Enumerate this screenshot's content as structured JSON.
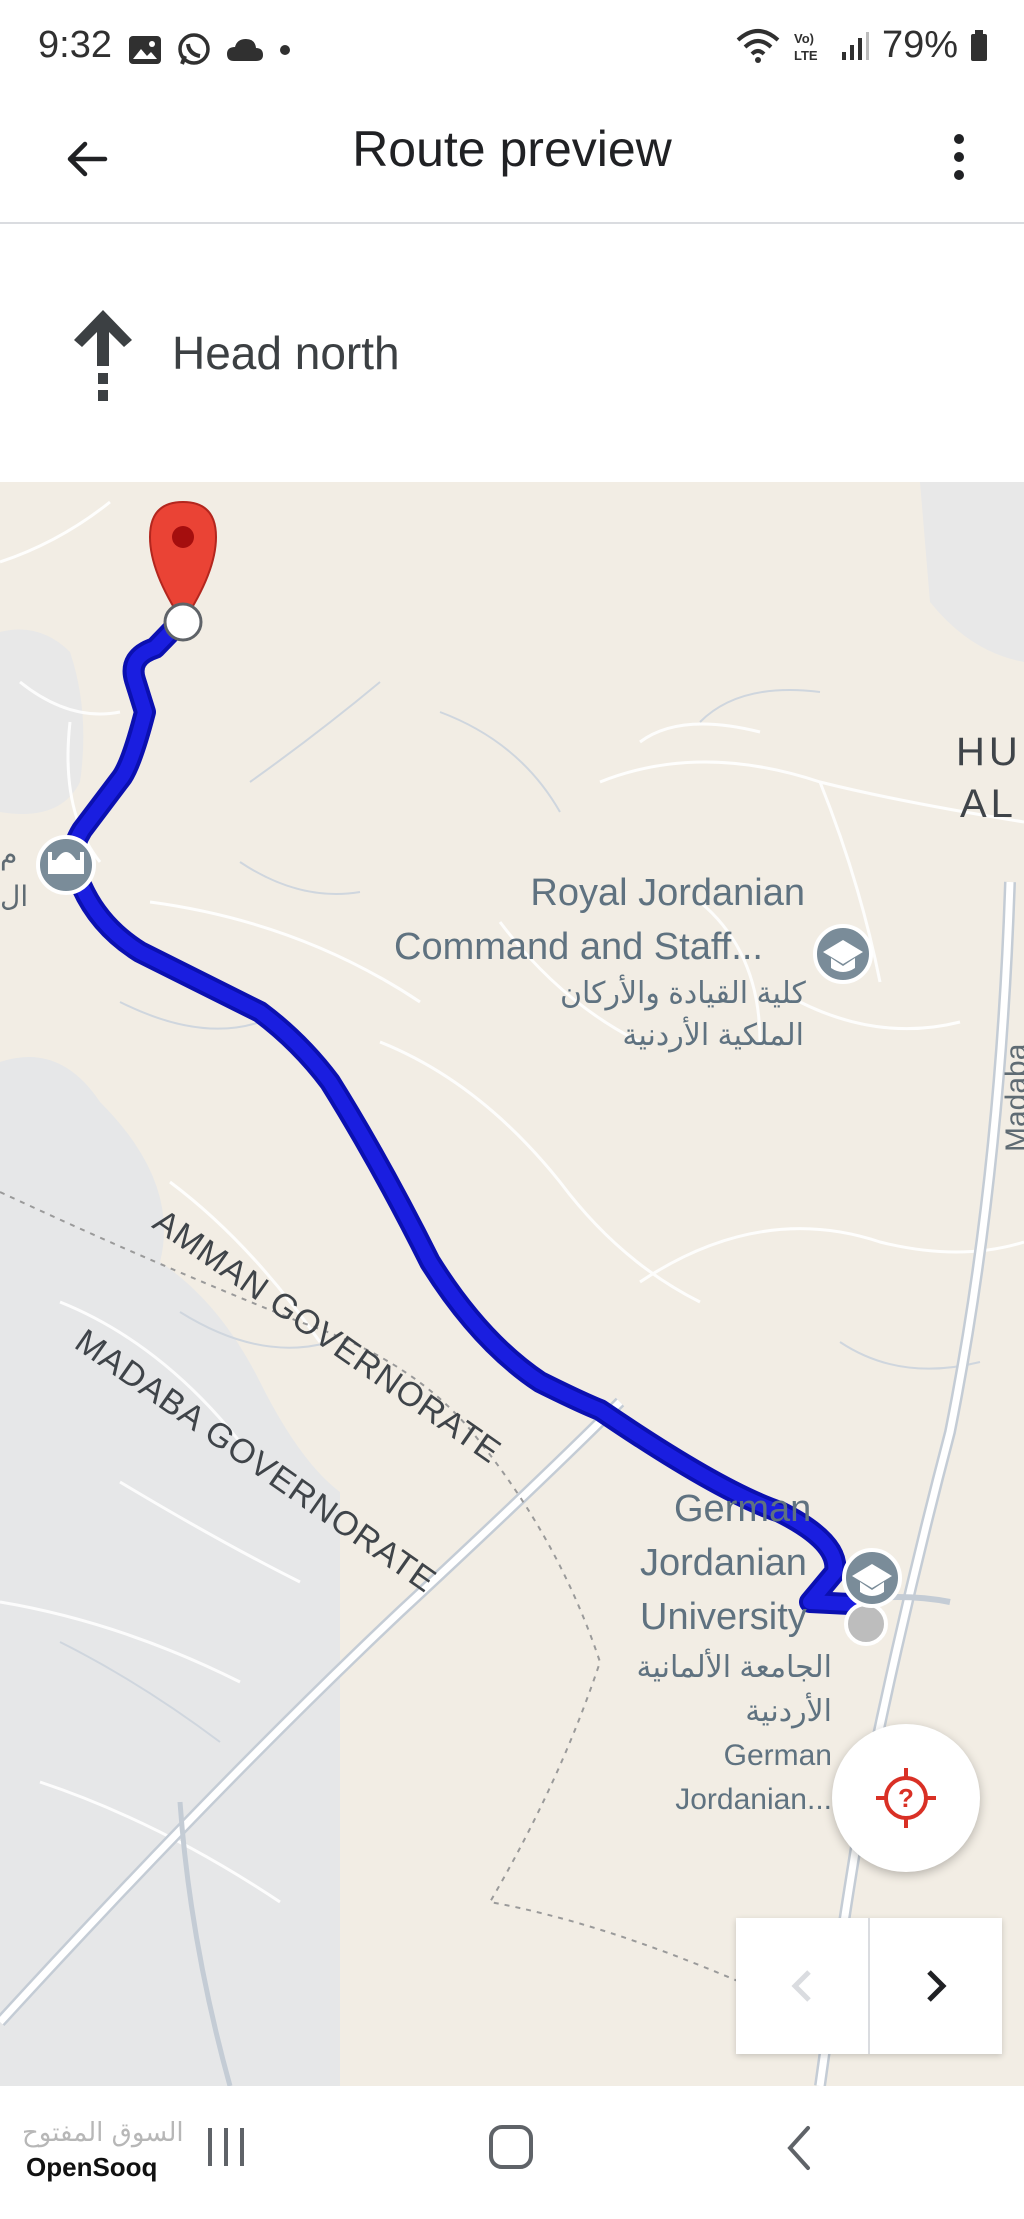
{
  "status": {
    "time": "9:32",
    "battery": "79%",
    "left_icons": [
      "gallery-icon",
      "whatsapp-icon",
      "cloud-icon",
      "dot-icon"
    ],
    "right_icons": [
      "wifi-icon",
      "volte-icon",
      "signal-icon",
      "battery-icon"
    ],
    "volte_label": "Vo) LTE"
  },
  "app_bar": {
    "title": "Route preview",
    "back_icon": "arrow-back-icon",
    "menu_icon": "more-vert-icon"
  },
  "direction": {
    "text": "Head north",
    "icon": "arrow-up-icon"
  },
  "map": {
    "colors": {
      "route": "#1a1ee0",
      "route_border": "#0b10b0",
      "pin": "#ea4335",
      "poi": "#7a8c99"
    },
    "labels": {
      "royal_line1": "Royal Jordanian",
      "royal_line2": "Command and Staff...",
      "royal_ar_line1": "كلية القيادة والأركان",
      "royal_ar_line2": "الملكية الأردنية",
      "gju_line1": "German",
      "gju_line2": "Jordanian",
      "gju_line3": "University",
      "gju_ar_line1": "الجامعة الألمانية",
      "gju_ar_line2": "الأردنية",
      "gju2_line1": "German",
      "gju2_line2": "Jordanian...",
      "amman_gov": "AMMAN GOVERNORATE",
      "madaba_gov": "MADABA GOVERNORATE",
      "hu_line1": "HU",
      "hu_line2": "AL",
      "madaba_road": "Madaba",
      "left_ar1": "م",
      "left_ar2": "ال"
    }
  },
  "controls": {
    "recenter_icon": "location-unknown-icon",
    "prev_icon": "chevron-left-icon",
    "next_icon": "chevron-right-icon"
  },
  "system_nav": {
    "watermark_ar": "السوق المفتوح",
    "watermark_en": "OpenSooq",
    "recents_icon": "recents-icon",
    "home_icon": "home-icon",
    "back_icon": "system-back-icon"
  }
}
